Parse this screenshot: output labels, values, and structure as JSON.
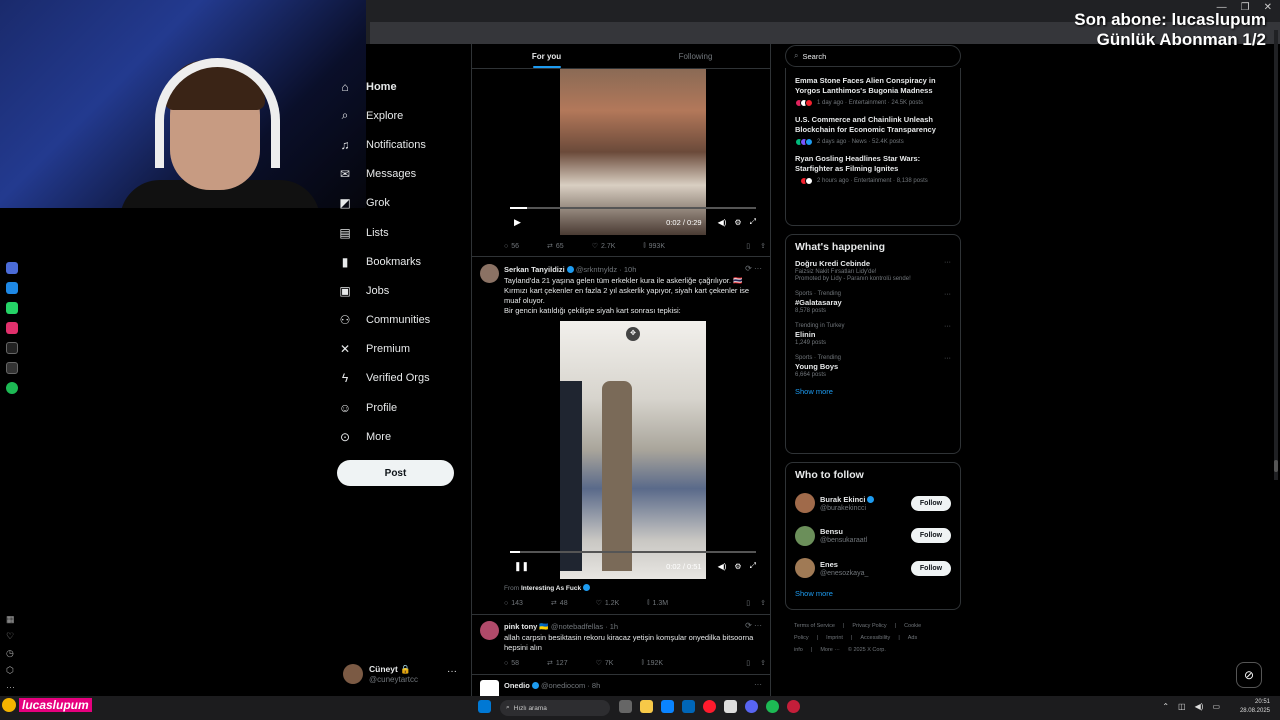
{
  "overlay": {
    "line1": "Son abone: lucaslupum",
    "line2": "Günlük Abonman 1/2"
  },
  "nav": {
    "items": [
      {
        "label": "Home",
        "icon": "home-icon",
        "glyph": "⌂"
      },
      {
        "label": "Explore",
        "icon": "search-icon",
        "glyph": "⌕"
      },
      {
        "label": "Notifications",
        "icon": "bell-icon",
        "glyph": "♫"
      },
      {
        "label": "Messages",
        "icon": "mail-icon",
        "glyph": "✉"
      },
      {
        "label": "Grok",
        "icon": "grok-icon",
        "glyph": "◩"
      },
      {
        "label": "Lists",
        "icon": "list-icon",
        "glyph": "▤"
      },
      {
        "label": "Bookmarks",
        "icon": "bookmark-icon",
        "glyph": "▮"
      },
      {
        "label": "Jobs",
        "icon": "briefcase-icon",
        "glyph": "▣"
      },
      {
        "label": "Communities",
        "icon": "people-icon",
        "glyph": "⚇"
      },
      {
        "label": "Premium",
        "icon": "x-logo-icon",
        "glyph": "✕"
      },
      {
        "label": "Verified Orgs",
        "icon": "lightning-icon",
        "glyph": "ϟ"
      },
      {
        "label": "Profile",
        "icon": "person-icon",
        "glyph": "☺"
      },
      {
        "label": "More",
        "icon": "more-circle-icon",
        "glyph": "⊙"
      }
    ],
    "post_label": "Post"
  },
  "account": {
    "name": "Cüneyt 🔒",
    "handle": "@cuneytartcc",
    "more": "···"
  },
  "feed": {
    "tabs": [
      "For you",
      "Following"
    ],
    "video1": {
      "time": "0:02 / 0:29",
      "progress": 0.07,
      "stats": {
        "replies": "56",
        "reposts": "65",
        "likes": "2.7K",
        "views": "993K"
      }
    },
    "tweet2": {
      "name": "Serkan Tanyildizi",
      "handle": "@srkntnyldz · 10h",
      "text1": "Tayland'da 21 yaşına gelen tüm erkekler kura ile askerliğe çağrılıyor. 🇹🇭",
      "text2": "Kırmızı kart çekenler en fazla 2 yıl askerlik yapıyor, siyah kart çekenler ise muaf oluyor.",
      "text3": "Bir gencin katıldığı çekilişte siyah kart sonrası tepkisi:",
      "time": "0:02 / 0:51",
      "progress": 0.04,
      "from_prefix": "From",
      "from_name": "Interesting As Fuck",
      "stats": {
        "replies": "143",
        "reposts": "48",
        "likes": "1.2K",
        "views": "1.3M"
      }
    },
    "tweet3": {
      "name": "pink tony 🇺🇦",
      "handle": "@notebadfellas · 1h",
      "text": "allah carpsin besiktasin rekoru kiracaz yetişin komşular onyedilka bitsoorna hepsini alın",
      "stats": {
        "replies": "58",
        "reposts": "127",
        "likes": "7K",
        "views": "192K"
      }
    },
    "tweet4": {
      "name": "Onedio",
      "handle": "@onediocom · 8h"
    }
  },
  "search": {
    "placeholder": "Search"
  },
  "news": [
    {
      "title": "Emma Stone Faces Alien Conspiracy in Yorgos Lanthimos's Bugonia Madness",
      "meta": "1 day ago · Entertainment · 24.5K posts"
    },
    {
      "title": "U.S. Commerce and Chainlink Unleash Blockchain for Economic Transparency",
      "meta": "2 days ago · News · 52.4K posts"
    },
    {
      "title": "Ryan Gosling Headlines Star Wars: Starfighter as Filming Ignites",
      "meta": "2 hours ago · Entertainment · 8,138 posts"
    }
  ],
  "happening": {
    "title": "What's happening",
    "trends": [
      {
        "cat": "",
        "name": "Doğru Kredi Cebinde",
        "count": "Faizsiz Nakit Fırsatları Lidy'de!",
        "extra": "Promoted by Lidy - Paranın kontrolü sende!"
      },
      {
        "cat": "Sports · Trending",
        "name": "#Galatasaray",
        "count": "8,578 posts",
        "extra": ""
      },
      {
        "cat": "Trending in Turkey",
        "name": "Elinin",
        "count": "1,249 posts",
        "extra": ""
      },
      {
        "cat": "Sports · Trending",
        "name": "Young Boys",
        "count": "6,664 posts",
        "extra": ""
      }
    ],
    "show_more": "Show more"
  },
  "who_to_follow": {
    "title": "Who to follow",
    "people": [
      {
        "name": "Burak Ekinci",
        "handle": "@burakekincci",
        "verified": true,
        "color": "#a06a4a"
      },
      {
        "name": "Bensu",
        "handle": "@bensukaraatl",
        "verified": false,
        "color": "#6b8f5a"
      },
      {
        "name": "Enes",
        "handle": "@enesozkaya_",
        "verified": false,
        "color": "#a07a55"
      }
    ],
    "follow_label": "Follow",
    "show_more": "Show more"
  },
  "footer": {
    "links": [
      "Terms of Service",
      "|",
      "Privacy Policy",
      "|",
      "Cookie Policy",
      "|",
      "Imprint",
      "|",
      "Accessibility",
      "|",
      "Ads info",
      "|",
      "More ···",
      "© 2025 X Corp."
    ]
  },
  "taskbar": {
    "username": "lucaslupum",
    "search": "Hızlı arama",
    "time": "20:51",
    "date": "28.08.2025"
  },
  "colors": {
    "accent": "#1d9bf0",
    "background": "#000000",
    "border": "#2f3336",
    "text_secondary": "#71767b"
  }
}
